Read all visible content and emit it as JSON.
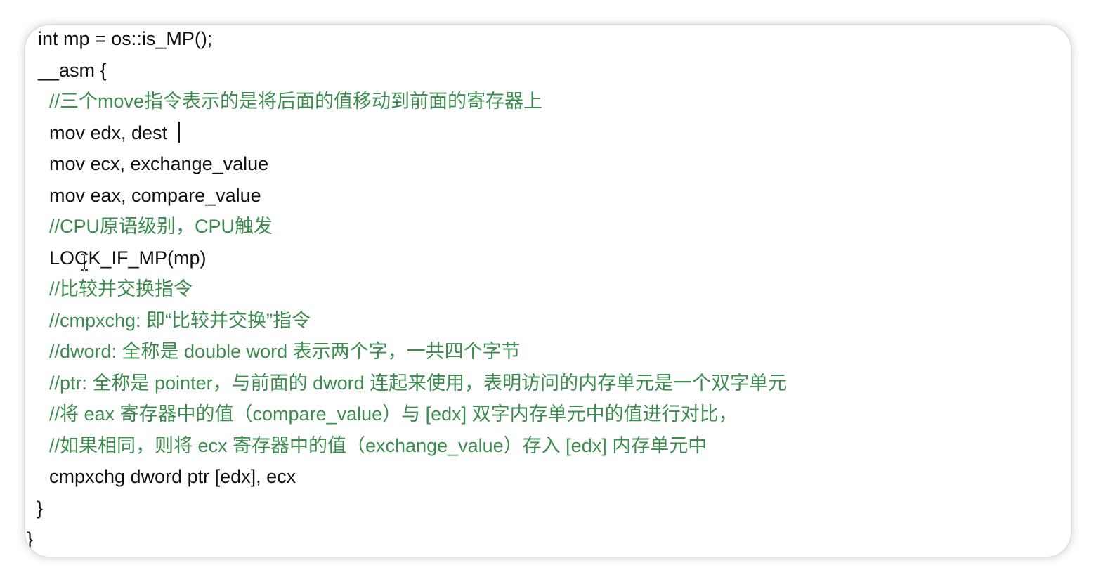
{
  "editor": {
    "lines": [
      {
        "text": "int mp = os::is_MP();",
        "kind": "code"
      },
      {
        "text": "__asm {",
        "kind": "code"
      },
      {
        "text": "//三个move指令表示的是将后面的值移动到前面的寄存器上",
        "kind": "comment"
      },
      {
        "text": "mov edx, dest",
        "kind": "code"
      },
      {
        "text": "mov ecx, exchange_value",
        "kind": "code"
      },
      {
        "text": "mov eax, compare_value",
        "kind": "code"
      },
      {
        "text": "//CPU原语级别，CPU触发",
        "kind": "comment"
      },
      {
        "text": "LOCK_IF_MP(mp)",
        "kind": "code"
      },
      {
        "text": "//比较并交换指令",
        "kind": "comment"
      },
      {
        "text": "//cmpxchg: 即“比较并交换”指令",
        "kind": "comment"
      },
      {
        "text": "//dword: 全称是 double word 表示两个字，一共四个字节",
        "kind": "comment"
      },
      {
        "text": "//ptr: 全称是 pointer，与前面的 dword 连起来使用，表明访问的内存单元是一个双字单元",
        "kind": "comment"
      },
      {
        "text": "//将 eax 寄存器中的值（compare_value）与 [edx] 双字内存单元中的值进行对比，",
        "kind": "comment"
      },
      {
        "text": "//如果相同，则将 ecx 寄存器中的值（exchange_value）存入 [edx] 内存单元中",
        "kind": "comment"
      },
      {
        "text": "cmpxchg dword ptr [edx], ecx",
        "kind": "code"
      },
      {
        "text": "}",
        "kind": "code"
      },
      {
        "text": "}",
        "kind": "code"
      }
    ],
    "colors": {
      "code": "#111111",
      "comment": "#3c8c4e"
    }
  }
}
